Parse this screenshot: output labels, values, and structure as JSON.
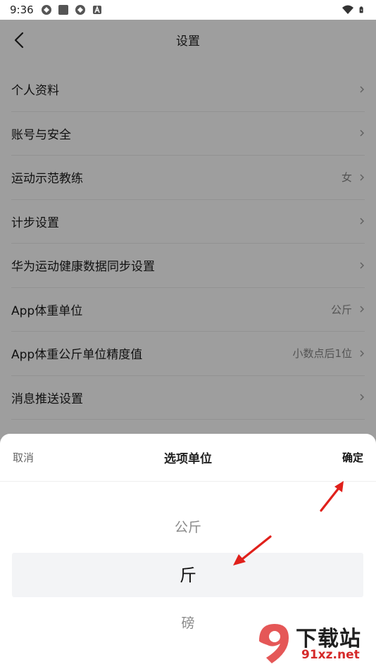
{
  "status_bar": {
    "time": "9:36"
  },
  "header": {
    "title": "设置"
  },
  "settings_items": [
    {
      "label": "个人资料",
      "value": ""
    },
    {
      "label": "账号与安全",
      "value": ""
    },
    {
      "label": "运动示范教练",
      "value": "女"
    },
    {
      "label": "计步设置",
      "value": ""
    },
    {
      "label": "华为运动健康数据同步设置",
      "value": ""
    },
    {
      "label": "App体重单位",
      "value": "公斤"
    },
    {
      "label": "App体重公斤单位精度值",
      "value": "小数点后1位"
    },
    {
      "label": "消息推送设置",
      "value": ""
    }
  ],
  "sheet": {
    "cancel": "取消",
    "title": "选项单位",
    "confirm": "确定",
    "options": [
      "公斤",
      "斤",
      "磅"
    ],
    "selected": "斤"
  },
  "watermark": {
    "line1": "下载站",
    "line2": "91xz.net"
  },
  "colors": {
    "arrow": "#e0201b",
    "overlay": "rgba(0,0,0,0.38)",
    "highlight": "#f3f4f6"
  }
}
